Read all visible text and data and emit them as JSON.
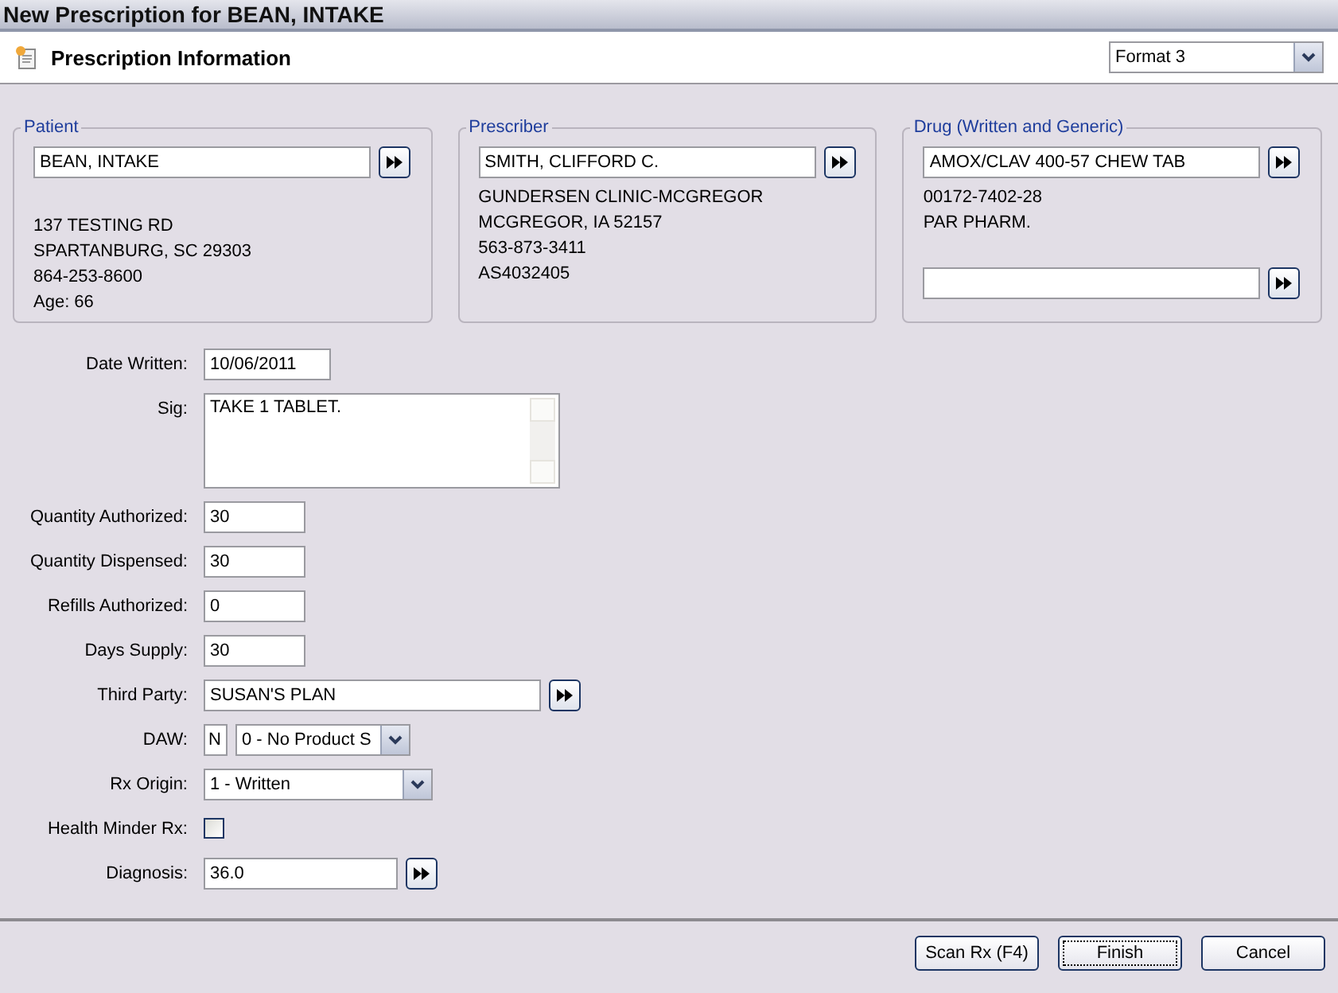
{
  "window": {
    "title": "New Prescription for BEAN, INTAKE"
  },
  "header": {
    "title": "Prescription Information",
    "format": "Format 3"
  },
  "groups": [
    {
      "title": "Patient",
      "items": [
        {
          "kind": "lookup",
          "value": "BEAN, INTAKE"
        },
        {
          "kind": "gap"
        },
        {
          "kind": "text",
          "text": "137 TESTING RD"
        },
        {
          "kind": "text",
          "text": "SPARTANBURG, SC 29303"
        },
        {
          "kind": "text",
          "text": "864-253-8600"
        },
        {
          "kind": "text",
          "text": "Age: 66"
        }
      ]
    },
    {
      "title": "Prescriber",
      "items": [
        {
          "kind": "lookup",
          "value": "SMITH, CLIFFORD C."
        },
        {
          "kind": "text",
          "text": "GUNDERSEN CLINIC-MCGREGOR"
        },
        {
          "kind": "text",
          "text": "MCGREGOR, IA 52157"
        },
        {
          "kind": "text",
          "text": "563-873-3411"
        },
        {
          "kind": "text",
          "text": "AS4032405"
        }
      ]
    },
    {
      "title": "Drug (Written and Generic)",
      "items": [
        {
          "kind": "lookup",
          "value": "AMOX/CLAV 400-57 CHEW TAB"
        },
        {
          "kind": "text",
          "text": "00172-7402-28"
        },
        {
          "kind": "text",
          "text": "PAR PHARM."
        },
        {
          "kind": "gap"
        },
        {
          "kind": "lookup"
        }
      ]
    }
  ],
  "form": [
    {
      "kind": "text",
      "label": "Date Written:",
      "value": "10/06/2011"
    },
    {
      "kind": "textarea",
      "label": "Sig:",
      "value": "TAKE 1 TABLET."
    },
    {
      "kind": "text",
      "label": "Quantity Authorized:",
      "value": "30"
    },
    {
      "kind": "text",
      "label": "Quantity Dispensed:",
      "value": "30"
    },
    {
      "kind": "text",
      "label": "Refills Authorized:",
      "value": "0"
    },
    {
      "kind": "text",
      "label": "Days Supply:",
      "value": "30"
    },
    {
      "kind": "lookup",
      "label": "Third Party:",
      "value": "SUSAN'S PLAN"
    },
    {
      "kind": "daw",
      "label": "DAW:",
      "code": "N",
      "value": "0 - No Product S"
    },
    {
      "kind": "select",
      "label": "Rx Origin:",
      "value": "1 - Written"
    },
    {
      "kind": "checkbox",
      "label": "Health Minder Rx:",
      "checked": false
    },
    {
      "kind": "lookup",
      "label": "Diagnosis:",
      "value": "36.0"
    }
  ],
  "buttons": [
    {
      "label": "Scan Rx (F4)",
      "focused": false
    },
    {
      "label": "Finish",
      "focused": true
    },
    {
      "label": "Cancel",
      "focused": false
    }
  ]
}
